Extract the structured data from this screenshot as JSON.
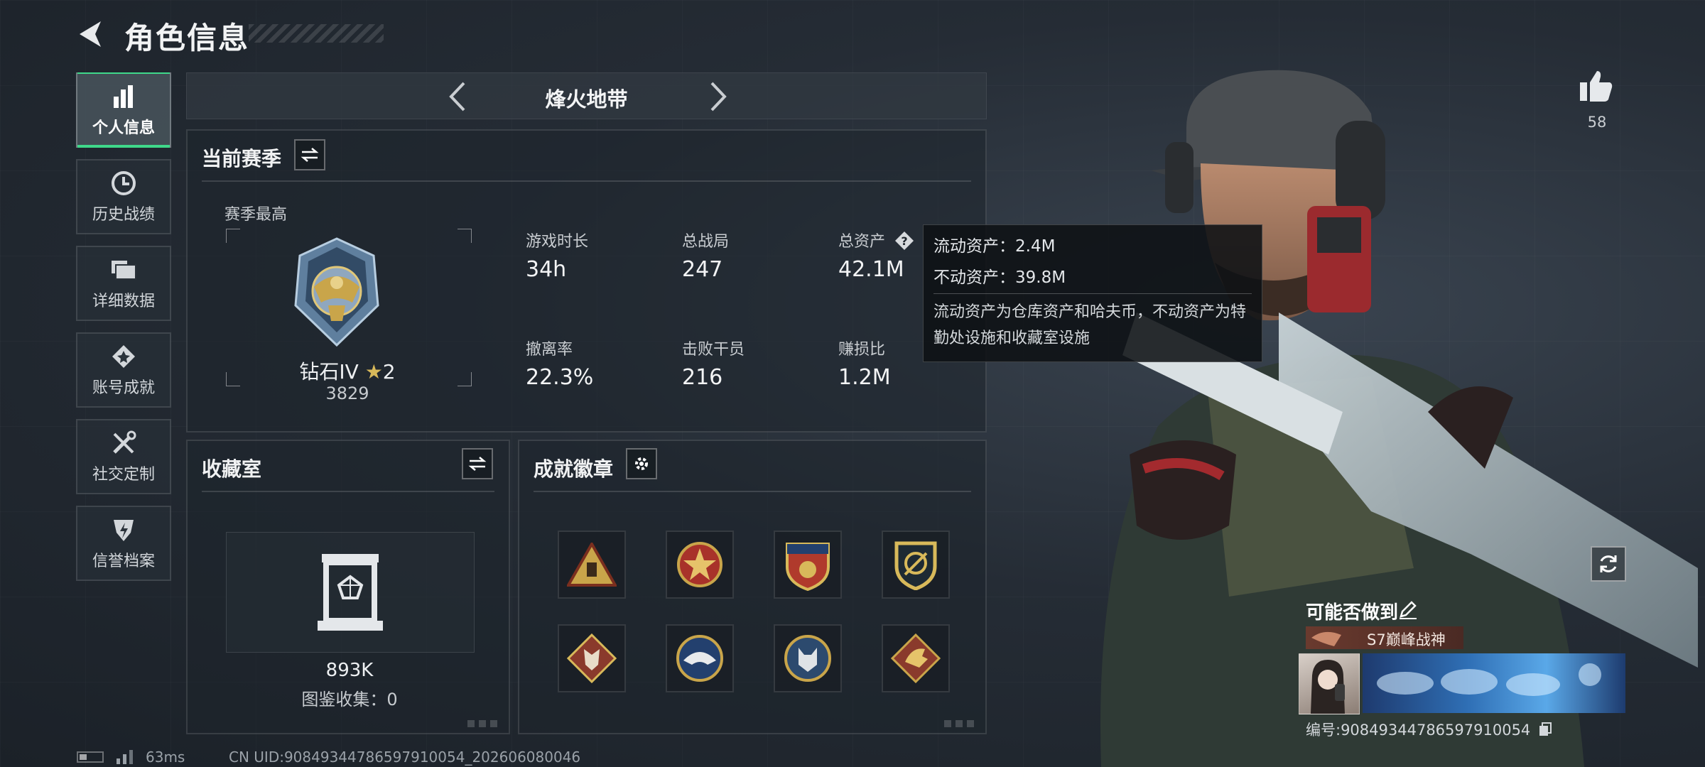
{
  "header": {
    "title": "角色信息"
  },
  "sidebar": {
    "items": [
      {
        "label": "个人信息",
        "icon": "bar-chart-icon",
        "active": true
      },
      {
        "label": "历史战绩",
        "icon": "history-icon"
      },
      {
        "label": "详细数据",
        "icon": "folder-icon"
      },
      {
        "label": "账号成就",
        "icon": "achievement-icon"
      },
      {
        "label": "社交定制",
        "icon": "tools-icon"
      },
      {
        "label": "信誉档案",
        "icon": "credit-icon"
      }
    ]
  },
  "mode": {
    "name": "烽火地带"
  },
  "season": {
    "title": "当前赛季",
    "best_label": "赛季最高",
    "rank_name": "钻石IV",
    "rank_stars": "2",
    "rank_score": "3829",
    "stats": [
      {
        "label": "游戏时长",
        "value": "34h"
      },
      {
        "label": "总战局",
        "value": "247"
      },
      {
        "label": "总资产",
        "value": "42.1M"
      },
      {
        "label": "撤离率",
        "value": "22.3%"
      },
      {
        "label": "击败干员",
        "value": "216"
      },
      {
        "label": "赚损比",
        "value": "1.2M"
      }
    ]
  },
  "tooltip": {
    "liquid": "流动资产：2.4M",
    "fixed": "不动资产：39.8M",
    "note": "流动资产为仓库资产和哈夫币，不动资产为特勤处设施和收藏室设施"
  },
  "collection": {
    "title": "收藏室",
    "value": "893K",
    "count_text": "图鉴收集：0"
  },
  "achievements": {
    "title": "成就徽章",
    "badges": [
      "triangle-badge-icon",
      "star-badge-icon",
      "shield-badge-icon",
      "crest-badge-icon",
      "wolf-badge-icon",
      "eagle-badge-icon",
      "lynx-badge-icon",
      "dragon-badge-icon"
    ]
  },
  "like": {
    "count": "58"
  },
  "card": {
    "name": "可能否做到",
    "title": "S7巅峰战神",
    "id_text": "编号:9084934478659791005​4"
  },
  "footer": {
    "ping": "63ms",
    "uid": "CN UID:908493447865979100​54_202606080046"
  },
  "colors": {
    "accent": "#3fd88a",
    "gold": "#c9a54a"
  }
}
